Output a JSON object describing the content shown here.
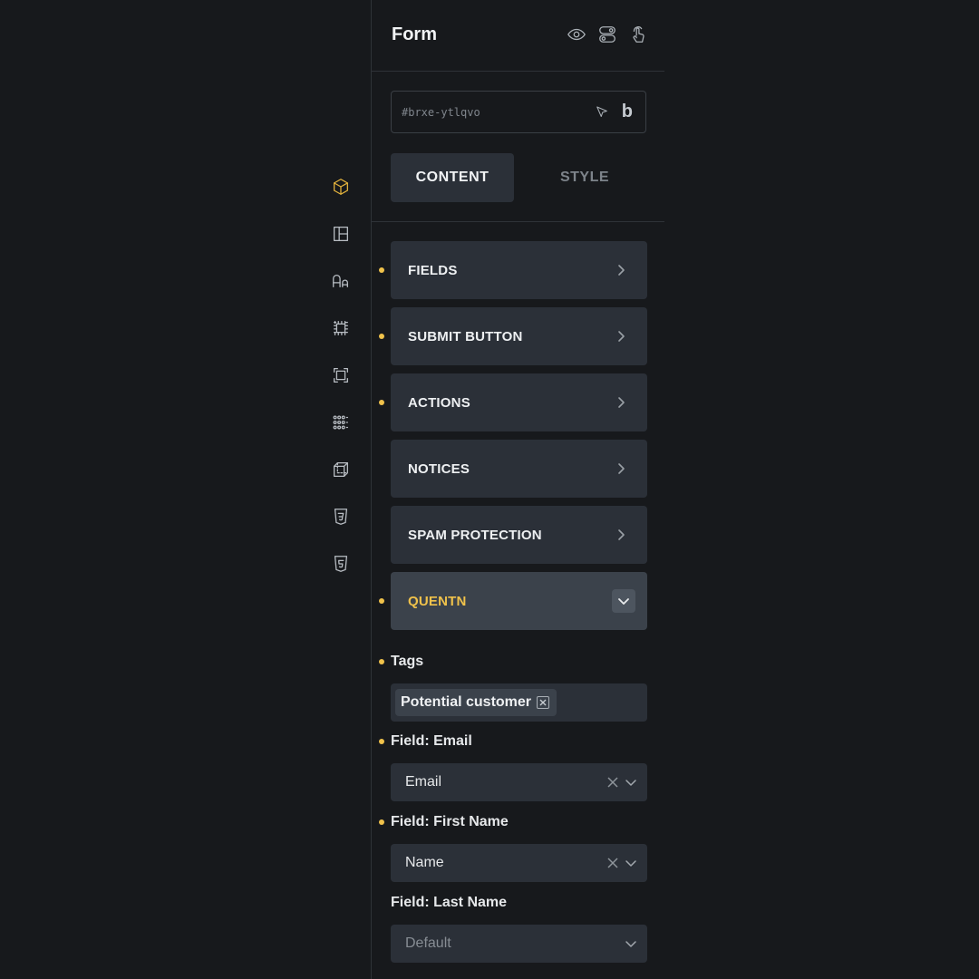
{
  "rail": {
    "items": [
      {
        "icon": "cube-icon",
        "active": true
      },
      {
        "icon": "layout-icon",
        "active": false
      },
      {
        "icon": "typography-icon",
        "active": false
      },
      {
        "icon": "spacing-icon",
        "active": false
      },
      {
        "icon": "frame-icon",
        "active": false
      },
      {
        "icon": "grid-dots-icon",
        "active": false
      },
      {
        "icon": "3d-box-icon",
        "active": false
      },
      {
        "icon": "css3-icon",
        "active": false
      },
      {
        "icon": "html5-icon",
        "active": false
      }
    ],
    "accent": "#e2b23c"
  },
  "panel": {
    "title": "Form",
    "header_icons": [
      "eye-icon",
      "toggle-icon",
      "pointer-hand-icon"
    ],
    "selector": {
      "id": "#brxe-ytlqvo",
      "brand_letter": "b"
    },
    "tabs": {
      "content": "CONTENT",
      "style": "STYLE",
      "active": "content"
    }
  },
  "groups": [
    {
      "label": "FIELDS",
      "modified": true,
      "open": false
    },
    {
      "label": "SUBMIT BUTTON",
      "modified": true,
      "open": false
    },
    {
      "label": "ACTIONS",
      "modified": true,
      "open": false
    },
    {
      "label": "NOTICES",
      "modified": false,
      "open": false
    },
    {
      "label": "SPAM PROTECTION",
      "modified": false,
      "open": false
    },
    {
      "label": "QUENTN",
      "modified": true,
      "open": true
    }
  ],
  "quentn": {
    "tags": {
      "label": "Tags",
      "values": [
        "Potential customer"
      ]
    },
    "field_email": {
      "label": "Field: Email",
      "value": "Email"
    },
    "field_first_name": {
      "label": "Field: First Name",
      "value": "Name"
    },
    "field_last_name": {
      "label": "Field: Last Name",
      "value": "Default"
    }
  },
  "colors": {
    "background": "#17191c",
    "surface": "#2b3038",
    "accent_yellow": "#f0c24b"
  }
}
